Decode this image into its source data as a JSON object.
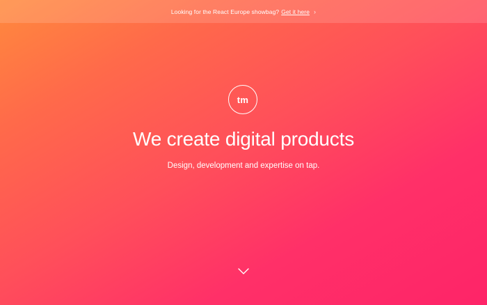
{
  "banner": {
    "text": "Looking for the React Europe showbag?",
    "link_label": "Get it here",
    "chevron_icon": "chevron-right-icon",
    "chevron_glyph": "›"
  },
  "logo": {
    "text": "tm"
  },
  "hero": {
    "headline": "We create digital products",
    "subheadline": "Design, development and expertise on tap."
  },
  "scroll": {
    "icon": "chevron-down-icon"
  },
  "colors": {
    "gradient_start": "#ff8a3d",
    "gradient_mid": "#ff4f5a",
    "gradient_end": "#fe2468",
    "text": "#ffffff"
  }
}
